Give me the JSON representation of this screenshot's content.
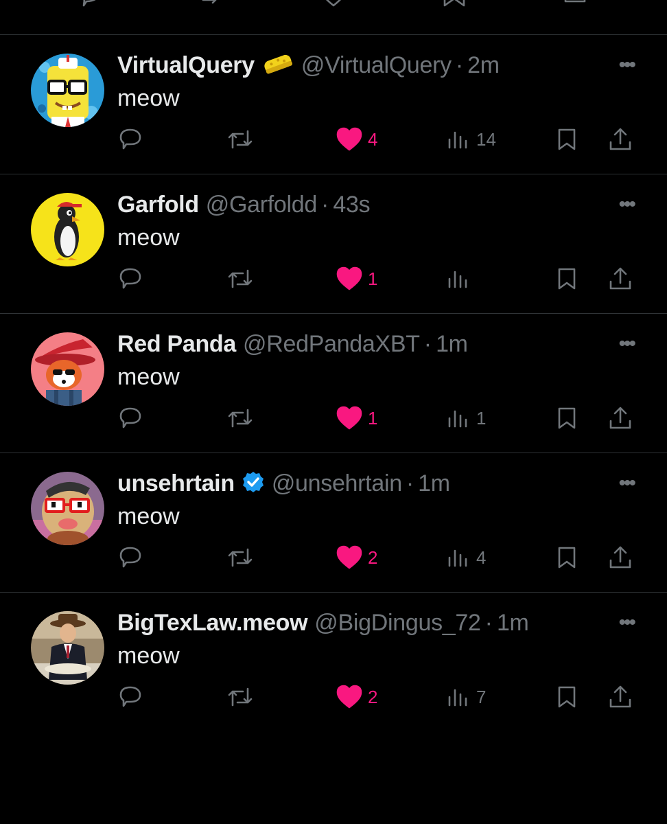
{
  "colors": {
    "background": "#000000",
    "text": "#e7e9ea",
    "muted": "#71767b",
    "like": "#f91880",
    "divider": "#2f3336",
    "verified": "#1d9bf0"
  },
  "top_actions": [
    "reply-icon",
    "retweet-icon",
    "like-icon",
    "bookmark-icon",
    "share-icon"
  ],
  "tweets": [
    {
      "name": "VirtualQuery",
      "badge": "sponge-emoji",
      "handle": "@VirtualQuery",
      "separator": "·",
      "time": "2m",
      "more": "•••",
      "text": "meow",
      "likes": "4",
      "views": "14",
      "liked": true
    },
    {
      "name": "Garfold",
      "badge": "",
      "handle": "@Garfoldd",
      "separator": "·",
      "time": "43s",
      "more": "•••",
      "text": "meow",
      "likes": "1",
      "views": "",
      "liked": true
    },
    {
      "name": "Red Panda",
      "badge": "",
      "handle": "@RedPandaXBT",
      "separator": "·",
      "time": "1m",
      "more": "•••",
      "text": "meow",
      "likes": "1",
      "views": "1",
      "liked": true
    },
    {
      "name": "unsehrtain",
      "badge": "verified-badge",
      "handle": "@unsehrtain",
      "separator": "·",
      "time": "1m",
      "more": "•••",
      "text": "meow",
      "likes": "2",
      "views": "4",
      "liked": true
    },
    {
      "name": "BigTexLaw.meow",
      "badge": "",
      "handle": "@BigDingus_72",
      "separator": "·",
      "time": "1m",
      "more": "•••",
      "text": "meow",
      "likes": "2",
      "views": "7",
      "liked": true
    }
  ]
}
